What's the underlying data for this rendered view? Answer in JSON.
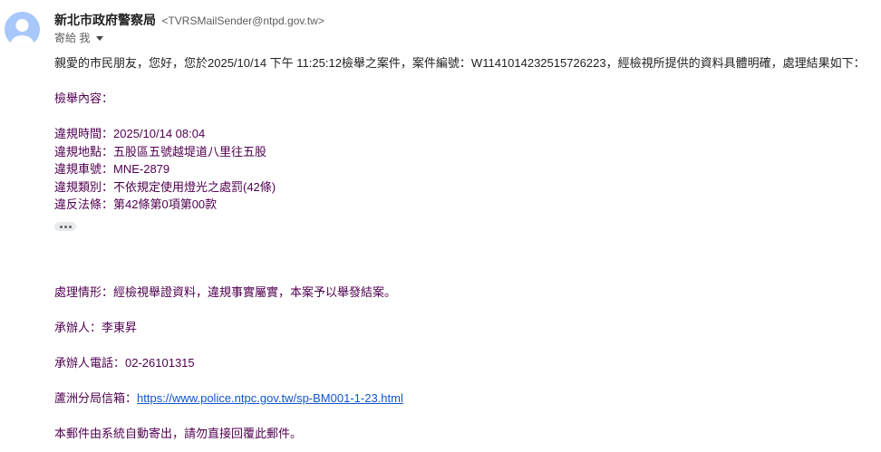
{
  "sender": {
    "name": "新北市政府警察局",
    "email": "<TVRSMailSender@ntpd.gov.tw>"
  },
  "recipient": {
    "label": "寄給 我"
  },
  "icons": {
    "avatar": "person-avatar-icon",
    "details_caret": "chevron-down-icon",
    "show_trimmed": "ellipsis-icon"
  },
  "colors": {
    "body_text": "#500050",
    "link": "#1155cc",
    "avatar_bg": "#a8c7fa"
  },
  "message": {
    "greeting": "親愛的市民朋友，您好，您於2025/10/14 下午 11:25:12檢舉之案件，案件編號：W1141014232515726223，經檢視所提供的資料具體明確，處理結果如下：",
    "report_heading": "檢舉內容：",
    "violation_time": "違規時間：2025/10/14 08:04",
    "violation_location": "違規地點：五股區五號越堤道八里往五股",
    "plate_number": "違規車號：MNE-2879",
    "violation_type": "違規類別：不依規定使用燈光之處罰(42條)",
    "law_article": "違反法條：第42條第0項第00款",
    "handling_status": "處理情形：經檢視舉證資料，違規事實屬實，本案予以舉發結案。",
    "handler": "承辦人：李東昇",
    "handler_phone": "承辦人電話：02-26101315",
    "mailbox_label": "蘆洲分局信箱：",
    "mailbox_url": "https://www.police.ntpc.gov.tw/sp-BM001-1-23.html",
    "auto_notice": "本郵件由系統自動寄出，請勿直接回覆此郵件。"
  }
}
